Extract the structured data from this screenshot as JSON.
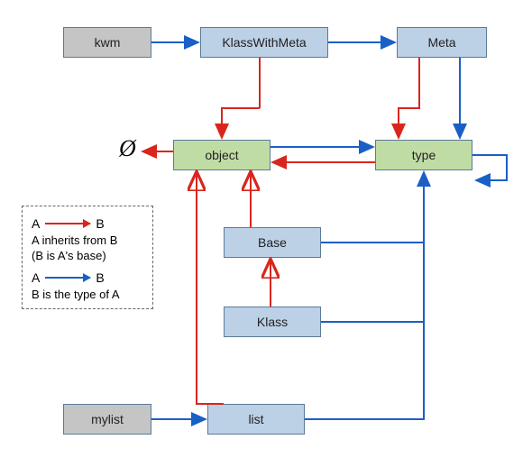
{
  "nodes": {
    "kwm": "kwm",
    "klasswithmeta": "KlassWithMeta",
    "meta": "Meta",
    "object": "object",
    "type": "type",
    "base": "Base",
    "klass": "Klass",
    "list": "list",
    "mylist": "mylist",
    "phi": "Ø"
  },
  "legend": {
    "A": "A",
    "B": "B",
    "inherits_line": "A inherits from B",
    "inherits_sub": "(B is A's base)",
    "typeof_line": "B is the type of A"
  },
  "chart_data": {
    "type": "diagram",
    "title": "",
    "nodes": [
      {
        "id": "kwm",
        "label": "kwm",
        "category": "instance"
      },
      {
        "id": "klasswithmeta",
        "label": "KlassWithMeta",
        "category": "class"
      },
      {
        "id": "meta",
        "label": "Meta",
        "category": "metaclass"
      },
      {
        "id": "object",
        "label": "object",
        "category": "builtin"
      },
      {
        "id": "type",
        "label": "type",
        "category": "builtin"
      },
      {
        "id": "base",
        "label": "Base",
        "category": "class"
      },
      {
        "id": "klass",
        "label": "Klass",
        "category": "class"
      },
      {
        "id": "list",
        "label": "list",
        "category": "class"
      },
      {
        "id": "mylist",
        "label": "mylist",
        "category": "instance"
      },
      {
        "id": "empty",
        "label": "Ø",
        "category": "none"
      }
    ],
    "edges": [
      {
        "from": "kwm",
        "to": "klasswithmeta",
        "kind": "typeof"
      },
      {
        "from": "klasswithmeta",
        "to": "meta",
        "kind": "typeof"
      },
      {
        "from": "klasswithmeta",
        "to": "object",
        "kind": "inherits"
      },
      {
        "from": "meta",
        "to": "type",
        "kind": "inherits"
      },
      {
        "from": "meta",
        "to": "type",
        "kind": "typeof"
      },
      {
        "from": "object",
        "to": "empty",
        "kind": "inherits"
      },
      {
        "from": "object",
        "to": "type",
        "kind": "typeof"
      },
      {
        "from": "type",
        "to": "object",
        "kind": "inherits"
      },
      {
        "from": "type",
        "to": "type",
        "kind": "typeof"
      },
      {
        "from": "base",
        "to": "object",
        "kind": "inherits"
      },
      {
        "from": "base",
        "to": "type",
        "kind": "typeof"
      },
      {
        "from": "klass",
        "to": "base",
        "kind": "inherits"
      },
      {
        "from": "klass",
        "to": "type",
        "kind": "typeof"
      },
      {
        "from": "list",
        "to": "object",
        "kind": "inherits"
      },
      {
        "from": "list",
        "to": "type",
        "kind": "typeof"
      },
      {
        "from": "mylist",
        "to": "list",
        "kind": "typeof"
      }
    ],
    "legend": {
      "inherits": {
        "color": "red",
        "meaning": "A inherits from B (B is A's base)"
      },
      "typeof": {
        "color": "blue",
        "meaning": "B is the type of A"
      }
    }
  }
}
